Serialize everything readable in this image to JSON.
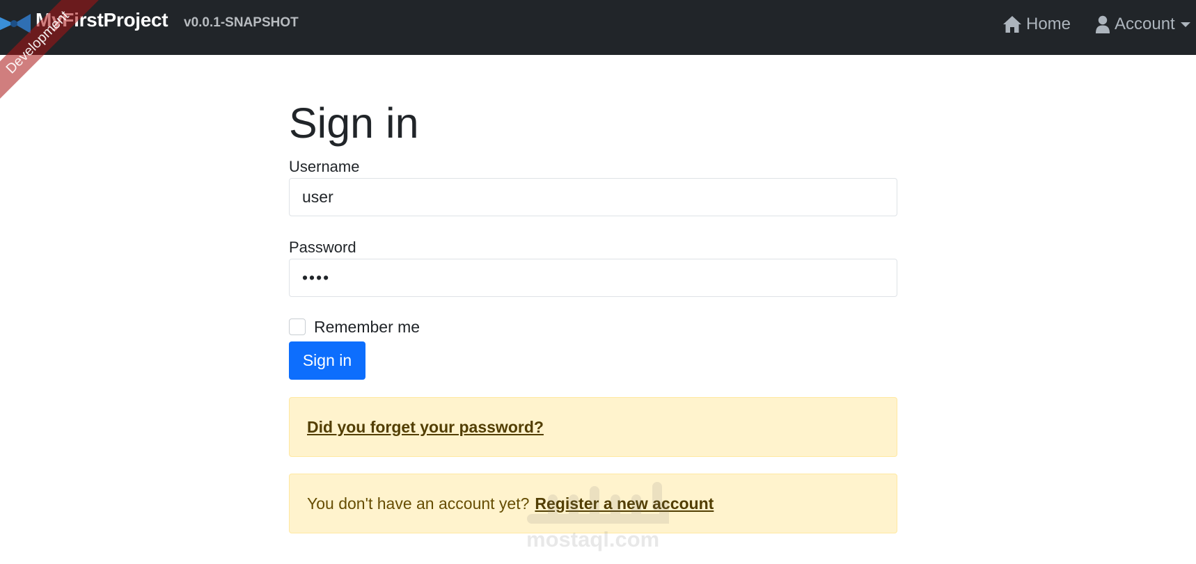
{
  "navbar": {
    "brand_name": "MyFirstProject",
    "version": "v0.0.1-SNAPSHOT",
    "ribbon": "Development",
    "home_label": "Home",
    "account_label": "Account",
    "background": "#212529",
    "link_color": "#adb5bd"
  },
  "form": {
    "title": "Sign in",
    "username_label": "Username",
    "username_value": "user",
    "password_label": "Password",
    "password_value": "user",
    "remember_label": "Remember me",
    "remember_checked": false,
    "submit_label": "Sign in",
    "submit_color": "#0d6efd"
  },
  "alerts": {
    "forgot_password_link": "Did you forget your password?",
    "no_account_text": "You don't have an account yet?",
    "register_link": "Register a new account",
    "background": "#fff3cd"
  },
  "watermark": {
    "text": "mostaql.com"
  },
  "icons": {
    "home": "home-icon",
    "account": "user-icon",
    "logo": "logo-icon"
  }
}
